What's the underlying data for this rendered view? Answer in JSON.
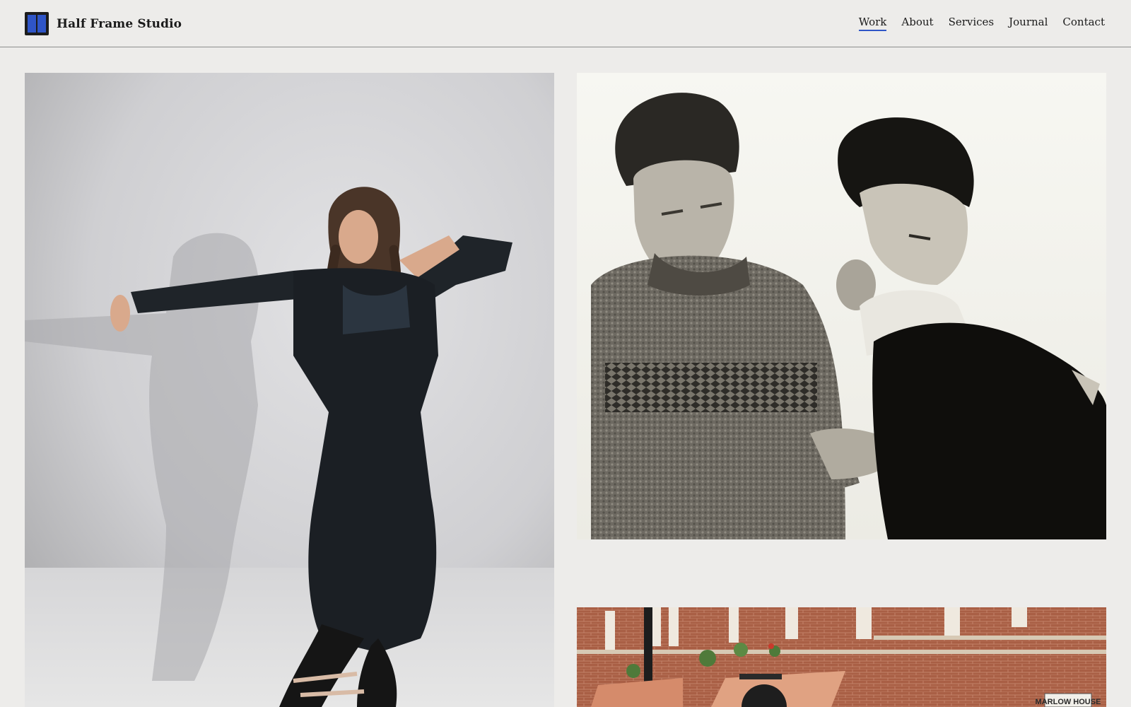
{
  "header": {
    "brand": "Half Frame Studio",
    "nav": [
      {
        "label": "Work",
        "active": true
      },
      {
        "label": "About",
        "active": false
      },
      {
        "label": "Services",
        "active": false
      },
      {
        "label": "Journal",
        "active": false
      },
      {
        "label": "Contact",
        "active": false
      }
    ]
  },
  "gallery": {
    "street_sign": "MARLOW HOUSE"
  },
  "colors": {
    "accent": "#2f55c7",
    "background": "#edecea"
  }
}
